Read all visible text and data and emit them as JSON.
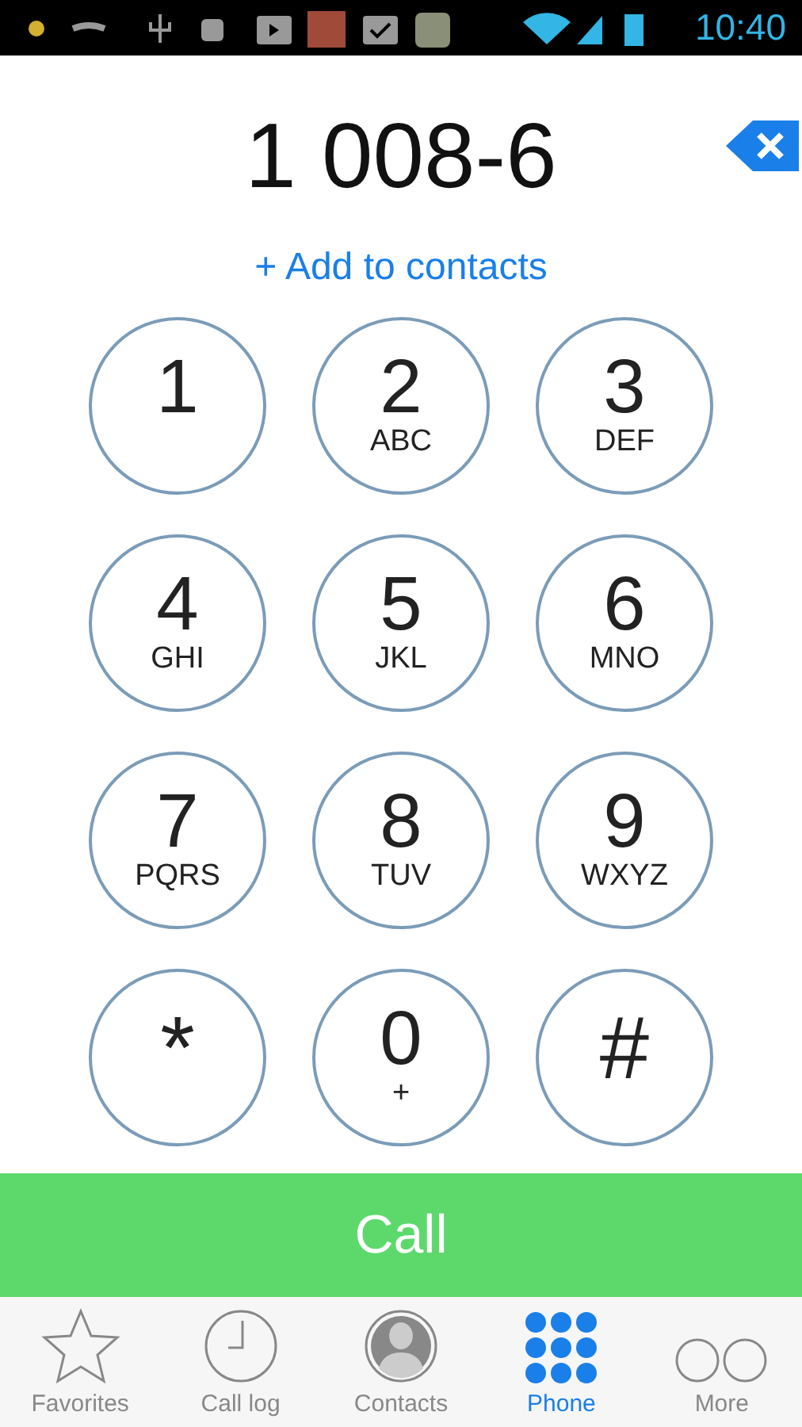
{
  "status_bar": {
    "time": "10:40"
  },
  "dialed_number": "1 008-6",
  "add_contact": "+ Add to contacts",
  "keys": [
    {
      "kind": "digit",
      "main": "1"
    },
    {
      "kind": "digit",
      "main": "2",
      "letters": "ABC"
    },
    {
      "kind": "digit",
      "main": "3",
      "letters": "DEF"
    },
    {
      "kind": "digit",
      "main": "4",
      "letters": "GHI"
    },
    {
      "kind": "digit",
      "main": "5",
      "letters": "JKL"
    },
    {
      "kind": "digit",
      "main": "6",
      "letters": "MNO"
    },
    {
      "kind": "digit",
      "main": "7",
      "letters": "PQRS"
    },
    {
      "kind": "digit",
      "main": "8",
      "letters": "TUV"
    },
    {
      "kind": "digit",
      "main": "9",
      "letters": "WXYZ"
    },
    {
      "kind": "symbol",
      "main": "*"
    },
    {
      "kind": "digit",
      "main": "0",
      "letters": "+"
    },
    {
      "kind": "symbol",
      "main": "#"
    }
  ],
  "call_button": "Call",
  "tabs": [
    {
      "label": "Favorites",
      "selected": false
    },
    {
      "label": "Call log",
      "selected": false
    },
    {
      "label": "Contacts",
      "selected": false
    },
    {
      "label": "Phone",
      "selected": true
    },
    {
      "label": "More",
      "selected": false
    }
  ]
}
